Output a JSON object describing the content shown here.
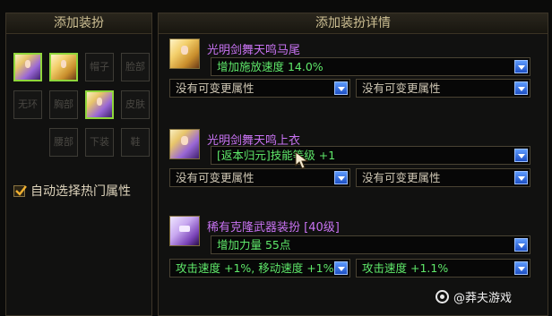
{
  "left_panel": {
    "title": "添加装扮",
    "slots": [
      {
        "label": "",
        "filled": true,
        "icon": "purple-avatar-icon"
      },
      {
        "label": "",
        "filled": true,
        "icon": "blonde-avatar-icon"
      },
      {
        "label": "帽子",
        "filled": false
      },
      {
        "label": "脸部",
        "filled": false
      },
      {
        "label": "无环",
        "filled": false
      },
      {
        "label": "胸部",
        "filled": false
      },
      {
        "label": "",
        "filled": true,
        "icon": "purple-coat-icon"
      },
      {
        "label": "皮肤",
        "filled": false
      },
      {
        "label": "腰部",
        "filled": false
      },
      {
        "label": "下装",
        "filled": false
      },
      {
        "label": "鞋",
        "filled": false
      }
    ],
    "auto_select": {
      "label": "自动选择热门属性",
      "checked": true
    }
  },
  "right_panel": {
    "title": "添加装扮详情",
    "items": [
      {
        "name": "光明剑舞天鸣马尾",
        "icon": "blonde-hair-avatar-icon",
        "main": "增加施放速度 14.0%",
        "subs": [
          "没有可变更属性",
          "没有可变更属性"
        ]
      },
      {
        "name": "光明剑舞天鸣上衣",
        "icon": "purple-coat-avatar-icon",
        "main": "[返本归元]技能等级 +1",
        "subs": [
          "没有可变更属性",
          "没有可变更属性"
        ]
      },
      {
        "name": "稀有克隆武器装扮 [40级]",
        "icon": "weapon-avatar-icon",
        "main": "增加力量 55点",
        "subs": [
          "攻击速度 +1%, 移动速度 +1%",
          "攻击速度 +1.1%"
        ]
      }
    ]
  },
  "watermark": "@莽夫游戏",
  "colors": {
    "accent_green": "#5fe86a",
    "item_name_purple": "#c873f2",
    "dropdown_arrow_blue": "#3a74e8"
  }
}
